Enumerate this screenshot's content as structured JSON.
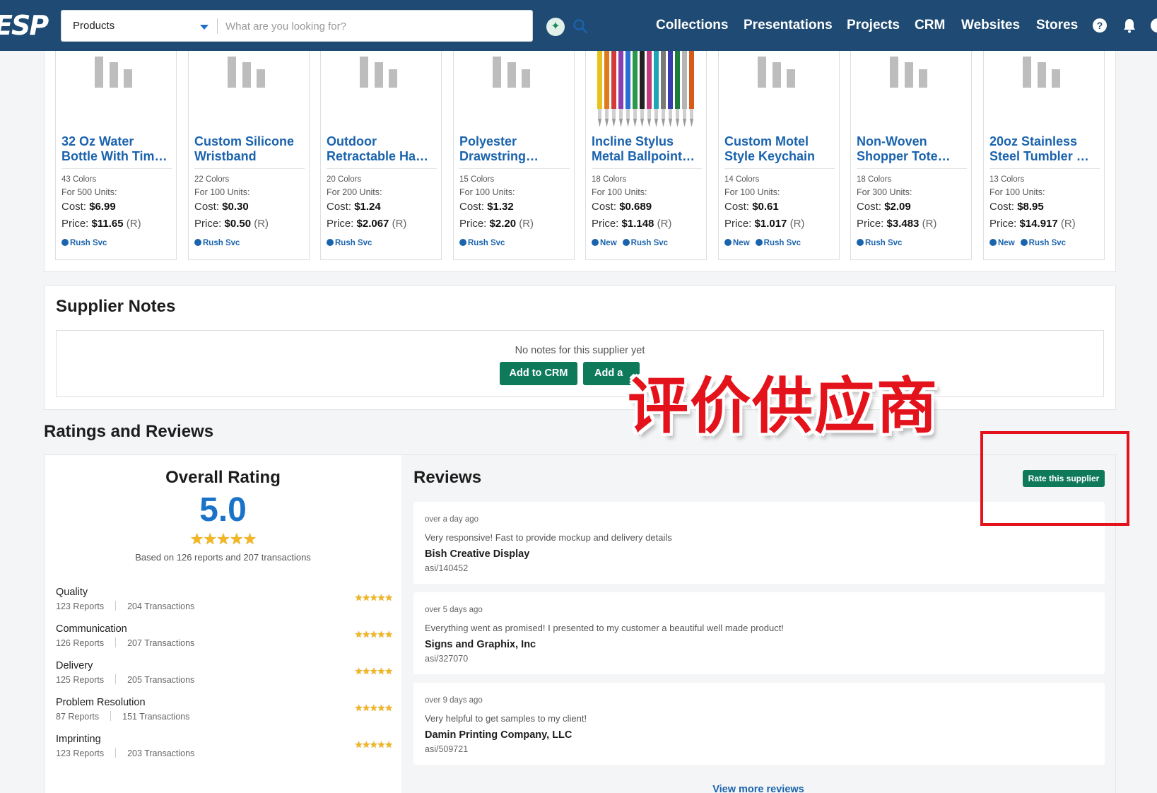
{
  "header": {
    "logo": "ESP",
    "search": {
      "category": "Products",
      "placeholder": "What are you looking for?"
    },
    "nav": [
      "Collections",
      "Presentations",
      "Projects",
      "CRM",
      "Websites",
      "Stores"
    ],
    "icons": [
      "help-icon",
      "bell-icon",
      "user-icon"
    ]
  },
  "products": [
    {
      "name1": "32 Oz Water",
      "name2": "Bottle With Tim…",
      "colors": "43 Colors",
      "units": "For 500 Units:",
      "cost_label": "Cost:",
      "cost": "$6.99",
      "price_label": "Price:",
      "price": "$11.65",
      "price_code": "(R)",
      "badges": [
        "Rush Svc"
      ]
    },
    {
      "name1": "Custom Silicone",
      "name2": "Wristband",
      "colors": "22 Colors",
      "units": "For 100 Units:",
      "cost_label": "Cost:",
      "cost": "$0.30",
      "price_label": "Price:",
      "price": "$0.50",
      "price_code": "(R)",
      "badges": [
        "Rush Svc"
      ]
    },
    {
      "name1": "Outdoor",
      "name2": "Retractable Ha…",
      "colors": "20 Colors",
      "units": "For 200 Units:",
      "cost_label": "Cost:",
      "cost": "$1.24",
      "price_label": "Price:",
      "price": "$2.067",
      "price_code": "(R)",
      "badges": [
        "Rush Svc"
      ]
    },
    {
      "name1": "Polyester",
      "name2": "Drawstring…",
      "colors": "15 Colors",
      "units": "For 100 Units:",
      "cost_label": "Cost:",
      "cost": "$1.32",
      "price_label": "Price:",
      "price": "$2.20",
      "price_code": "(R)",
      "badges": [
        "Rush Svc"
      ]
    },
    {
      "name1": "Incline Stylus",
      "name2": "Metal Ballpoint…",
      "colors": "18 Colors",
      "units": "For 100 Units:",
      "cost_label": "Cost:",
      "cost": "$0.689",
      "price_label": "Price:",
      "price": "$1.148",
      "price_code": "(R)",
      "badges": [
        "New",
        "Rush Svc"
      ]
    },
    {
      "name1": "Custom Motel",
      "name2": "Style Keychain",
      "colors": "14 Colors",
      "units": "For 100 Units:",
      "cost_label": "Cost:",
      "cost": "$0.61",
      "price_label": "Price:",
      "price": "$1.017",
      "price_code": "(R)",
      "badges": [
        "New",
        "Rush Svc"
      ]
    },
    {
      "name1": "Non-Woven",
      "name2": "Shopper Tote…",
      "colors": "18 Colors",
      "units": "For 300 Units:",
      "cost_label": "Cost:",
      "cost": "$2.09",
      "price_label": "Price:",
      "price": "$3.483",
      "price_code": "(R)",
      "badges": [
        "Rush Svc"
      ]
    },
    {
      "name1": "20oz Stainless",
      "name2": "Steel Tumbler …",
      "colors": "13 Colors",
      "units": "For 100 Units:",
      "cost_label": "Cost:",
      "cost": "$8.95",
      "price_label": "Price:",
      "price": "$14.917",
      "price_code": "(R)",
      "badges": [
        "New",
        "Rush Svc"
      ]
    }
  ],
  "notes": {
    "title": "Supplier Notes",
    "empty_text": "No notes for this supplier yet",
    "add_crm_label": "Add to CRM",
    "add_second_label": "Add a"
  },
  "overlay_caption": "评价供应商",
  "ratings": {
    "heading": "Ratings and Reviews",
    "overall_title": "Overall Rating",
    "score": "5.0",
    "stars": "★★★★★",
    "basis": "Based on 126 reports and 207 transactions",
    "rows": [
      {
        "name": "Quality",
        "reports": "123 Reports",
        "transactions": "204 Transactions",
        "stars": "★★★★★"
      },
      {
        "name": "Communication",
        "reports": "126 Reports",
        "transactions": "207 Transactions",
        "stars": "★★★★★"
      },
      {
        "name": "Delivery",
        "reports": "125 Reports",
        "transactions": "205 Transactions",
        "stars": "★★★★★"
      },
      {
        "name": "Problem Resolution",
        "reports": "87 Reports",
        "transactions": "151 Transactions",
        "stars": "★★★★★"
      },
      {
        "name": "Imprinting",
        "reports": "123 Reports",
        "transactions": "203 Transactions",
        "stars": "★★★★★"
      }
    ]
  },
  "reviews": {
    "title": "Reviews",
    "rate_label": "Rate this supplier",
    "items": [
      {
        "time": "over a day ago",
        "text": "Very responsive! Fast to provide mockup and delivery details",
        "company": "Bish Creative Display",
        "asi": "asi/140452"
      },
      {
        "time": "over 5 days ago",
        "text": "Everything went as promised! I presented to my customer a beautiful well made product!",
        "company": "Signs and Graphix, Inc",
        "asi": "asi/327070"
      },
      {
        "time": "over 9 days ago",
        "text": "Very helpful to get samples to my client!",
        "company": "Damin Printing Company, LLC",
        "asi": "asi/509721"
      }
    ],
    "view_more": "View more reviews"
  },
  "colors": {
    "nav_bg": "#1e4a73",
    "link_blue": "#1a63ad",
    "green": "#0e7a5a",
    "accent_red": "#e3121b",
    "star_gold": "#f2b61f"
  }
}
